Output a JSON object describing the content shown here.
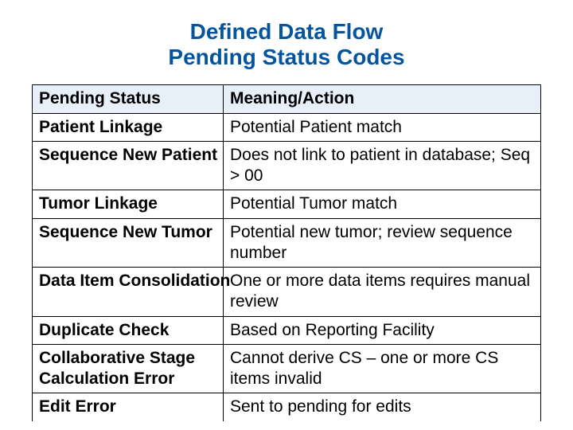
{
  "title_line1": "Defined Data Flow",
  "title_line2": "Pending Status Codes",
  "headers": {
    "status": "Pending Status",
    "meaning": "Meaning/Action"
  },
  "rows": [
    {
      "status": "Patient Linkage",
      "meaning": "Potential Patient match"
    },
    {
      "status": "Sequence New Patient",
      "meaning": "Does not link to patient in database; Seq > 00"
    },
    {
      "status": "Tumor Linkage",
      "meaning": "Potential Tumor match"
    },
    {
      "status": "Sequence New Tumor",
      "meaning": "Potential new tumor; review sequence number"
    },
    {
      "status": "Data Item Consolidation",
      "meaning": "One or more data items requires manual review"
    },
    {
      "status": "Duplicate Check",
      "meaning": "Based on Reporting Facility"
    },
    {
      "status": "Collaborative Stage Calculation Error",
      "meaning": "Cannot derive CS – one or more CS items invalid"
    },
    {
      "status": "Edit Error",
      "meaning": "Sent to pending for edits"
    }
  ]
}
